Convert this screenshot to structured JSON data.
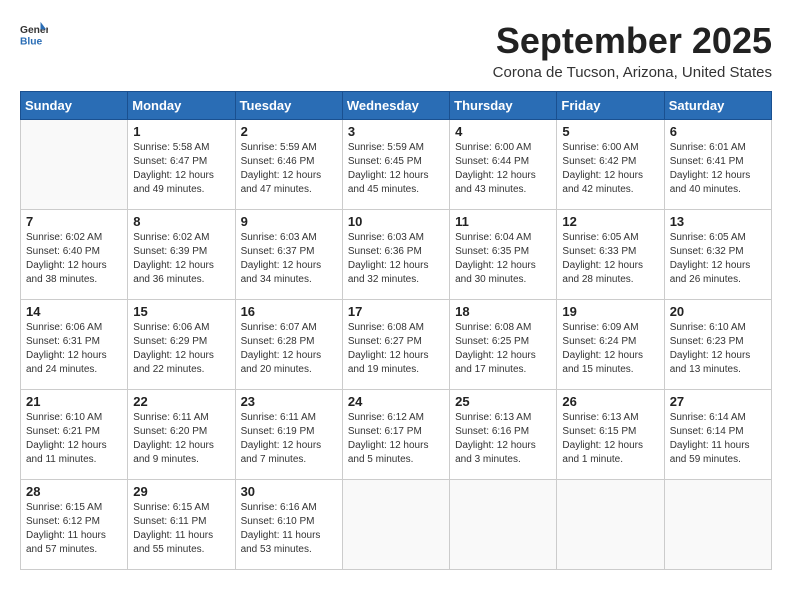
{
  "logo": {
    "general": "General",
    "blue": "Blue"
  },
  "title": "September 2025",
  "location": "Corona de Tucson, Arizona, United States",
  "days_of_week": [
    "Sunday",
    "Monday",
    "Tuesday",
    "Wednesday",
    "Thursday",
    "Friday",
    "Saturday"
  ],
  "weeks": [
    [
      {
        "day": "",
        "info": ""
      },
      {
        "day": "1",
        "info": "Sunrise: 5:58 AM\nSunset: 6:47 PM\nDaylight: 12 hours\nand 49 minutes."
      },
      {
        "day": "2",
        "info": "Sunrise: 5:59 AM\nSunset: 6:46 PM\nDaylight: 12 hours\nand 47 minutes."
      },
      {
        "day": "3",
        "info": "Sunrise: 5:59 AM\nSunset: 6:45 PM\nDaylight: 12 hours\nand 45 minutes."
      },
      {
        "day": "4",
        "info": "Sunrise: 6:00 AM\nSunset: 6:44 PM\nDaylight: 12 hours\nand 43 minutes."
      },
      {
        "day": "5",
        "info": "Sunrise: 6:00 AM\nSunset: 6:42 PM\nDaylight: 12 hours\nand 42 minutes."
      },
      {
        "day": "6",
        "info": "Sunrise: 6:01 AM\nSunset: 6:41 PM\nDaylight: 12 hours\nand 40 minutes."
      }
    ],
    [
      {
        "day": "7",
        "info": "Sunrise: 6:02 AM\nSunset: 6:40 PM\nDaylight: 12 hours\nand 38 minutes."
      },
      {
        "day": "8",
        "info": "Sunrise: 6:02 AM\nSunset: 6:39 PM\nDaylight: 12 hours\nand 36 minutes."
      },
      {
        "day": "9",
        "info": "Sunrise: 6:03 AM\nSunset: 6:37 PM\nDaylight: 12 hours\nand 34 minutes."
      },
      {
        "day": "10",
        "info": "Sunrise: 6:03 AM\nSunset: 6:36 PM\nDaylight: 12 hours\nand 32 minutes."
      },
      {
        "day": "11",
        "info": "Sunrise: 6:04 AM\nSunset: 6:35 PM\nDaylight: 12 hours\nand 30 minutes."
      },
      {
        "day": "12",
        "info": "Sunrise: 6:05 AM\nSunset: 6:33 PM\nDaylight: 12 hours\nand 28 minutes."
      },
      {
        "day": "13",
        "info": "Sunrise: 6:05 AM\nSunset: 6:32 PM\nDaylight: 12 hours\nand 26 minutes."
      }
    ],
    [
      {
        "day": "14",
        "info": "Sunrise: 6:06 AM\nSunset: 6:31 PM\nDaylight: 12 hours\nand 24 minutes."
      },
      {
        "day": "15",
        "info": "Sunrise: 6:06 AM\nSunset: 6:29 PM\nDaylight: 12 hours\nand 22 minutes."
      },
      {
        "day": "16",
        "info": "Sunrise: 6:07 AM\nSunset: 6:28 PM\nDaylight: 12 hours\nand 20 minutes."
      },
      {
        "day": "17",
        "info": "Sunrise: 6:08 AM\nSunset: 6:27 PM\nDaylight: 12 hours\nand 19 minutes."
      },
      {
        "day": "18",
        "info": "Sunrise: 6:08 AM\nSunset: 6:25 PM\nDaylight: 12 hours\nand 17 minutes."
      },
      {
        "day": "19",
        "info": "Sunrise: 6:09 AM\nSunset: 6:24 PM\nDaylight: 12 hours\nand 15 minutes."
      },
      {
        "day": "20",
        "info": "Sunrise: 6:10 AM\nSunset: 6:23 PM\nDaylight: 12 hours\nand 13 minutes."
      }
    ],
    [
      {
        "day": "21",
        "info": "Sunrise: 6:10 AM\nSunset: 6:21 PM\nDaylight: 12 hours\nand 11 minutes."
      },
      {
        "day": "22",
        "info": "Sunrise: 6:11 AM\nSunset: 6:20 PM\nDaylight: 12 hours\nand 9 minutes."
      },
      {
        "day": "23",
        "info": "Sunrise: 6:11 AM\nSunset: 6:19 PM\nDaylight: 12 hours\nand 7 minutes."
      },
      {
        "day": "24",
        "info": "Sunrise: 6:12 AM\nSunset: 6:17 PM\nDaylight: 12 hours\nand 5 minutes."
      },
      {
        "day": "25",
        "info": "Sunrise: 6:13 AM\nSunset: 6:16 PM\nDaylight: 12 hours\nand 3 minutes."
      },
      {
        "day": "26",
        "info": "Sunrise: 6:13 AM\nSunset: 6:15 PM\nDaylight: 12 hours\nand 1 minute."
      },
      {
        "day": "27",
        "info": "Sunrise: 6:14 AM\nSunset: 6:14 PM\nDaylight: 11 hours\nand 59 minutes."
      }
    ],
    [
      {
        "day": "28",
        "info": "Sunrise: 6:15 AM\nSunset: 6:12 PM\nDaylight: 11 hours\nand 57 minutes."
      },
      {
        "day": "29",
        "info": "Sunrise: 6:15 AM\nSunset: 6:11 PM\nDaylight: 11 hours\nand 55 minutes."
      },
      {
        "day": "30",
        "info": "Sunrise: 6:16 AM\nSunset: 6:10 PM\nDaylight: 11 hours\nand 53 minutes."
      },
      {
        "day": "",
        "info": ""
      },
      {
        "day": "",
        "info": ""
      },
      {
        "day": "",
        "info": ""
      },
      {
        "day": "",
        "info": ""
      }
    ]
  ]
}
